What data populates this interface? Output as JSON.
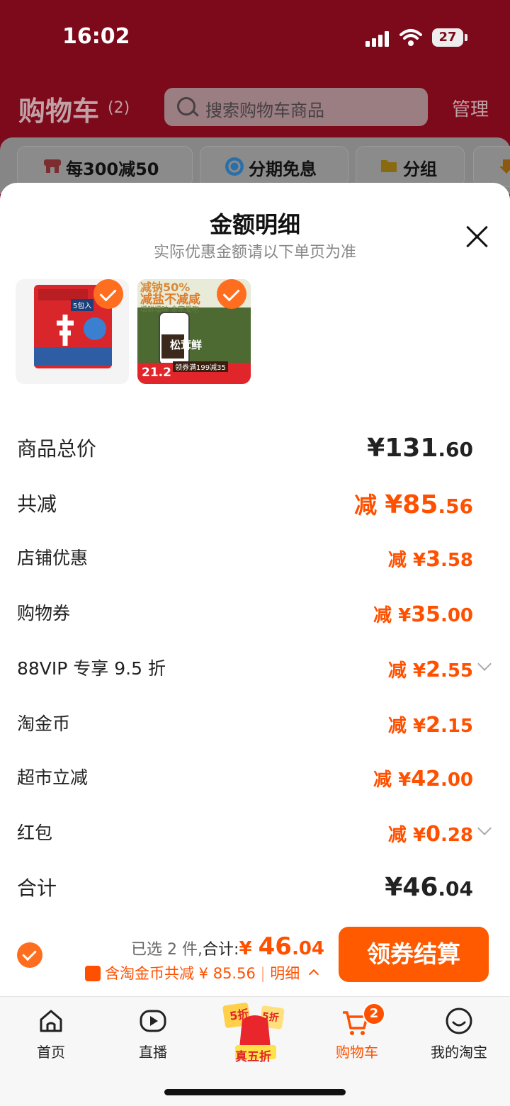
{
  "status_bar": {
    "time": "16:02",
    "battery": "27"
  },
  "header": {
    "title": "购物车",
    "count": "(2)",
    "search_placeholder": "搜索购物车商品",
    "manage": "管理"
  },
  "chips": [
    "每300减50",
    "分期免息",
    "分组"
  ],
  "modal": {
    "title": "金额明细",
    "subtitle": "实际优惠金额请以下单页为准",
    "products": [
      {
        "name": "辛拉面",
        "badge": "5包入",
        "selected": true
      },
      {
        "name": "松茸鲜",
        "headline1": "减钠50%",
        "headline2": "减盐不减咸",
        "tagline": "增鲜增味 金家爱吃",
        "price": "21.2",
        "coupon": "领券满199减35",
        "selected": true
      }
    ],
    "rows": [
      {
        "label": "商品总价",
        "prefix": "",
        "yuan": "¥",
        "int": "131",
        "dec": ".60"
      },
      {
        "label": "共减",
        "prefix": "减 ",
        "yuan": "¥",
        "int": "85",
        "dec": ".56"
      },
      {
        "label": "店铺优惠",
        "prefix": "减 ",
        "yuan": "¥",
        "int": "3",
        "dec": ".58"
      },
      {
        "label": "购物券",
        "prefix": "减 ",
        "yuan": "¥",
        "int": "35",
        "dec": ".00"
      },
      {
        "label": "88VIP 专享 9.5 折",
        "prefix": "减 ",
        "yuan": "¥",
        "int": "2",
        "dec": ".55"
      },
      {
        "label": "淘金币",
        "prefix": "减 ",
        "yuan": "¥",
        "int": "2",
        "dec": ".15"
      },
      {
        "label": "超市立减",
        "prefix": "减 ",
        "yuan": "¥",
        "int": "42",
        "dec": ".00"
      },
      {
        "label": "红包",
        "prefix": "减 ",
        "yuan": "¥",
        "int": "0",
        "dec": ".28"
      },
      {
        "label": "合计",
        "prefix": "",
        "yuan": "¥",
        "int": "46",
        "dec": ".04"
      }
    ]
  },
  "checkout": {
    "selected_prefix": "已选 2 件,",
    "total_label": "合计:",
    "yuan": "¥ ",
    "int": "46",
    "dec": ".04",
    "coin_text": "含淘金币共减 ¥ 85.56",
    "detail": "明细",
    "button": "领券结算"
  },
  "tabs": [
    {
      "label": "首页",
      "active": false
    },
    {
      "label": "直播",
      "active": false
    },
    {
      "label": "真五折",
      "active": false,
      "badges": [
        "5折",
        "5折"
      ]
    },
    {
      "label": "购物车",
      "active": true,
      "badge": "2"
    },
    {
      "label": "我的淘宝",
      "active": false
    }
  ],
  "colors": {
    "accent": "#ff5000",
    "header_bg": "#7d0a1b",
    "button": "#ff5a00"
  }
}
